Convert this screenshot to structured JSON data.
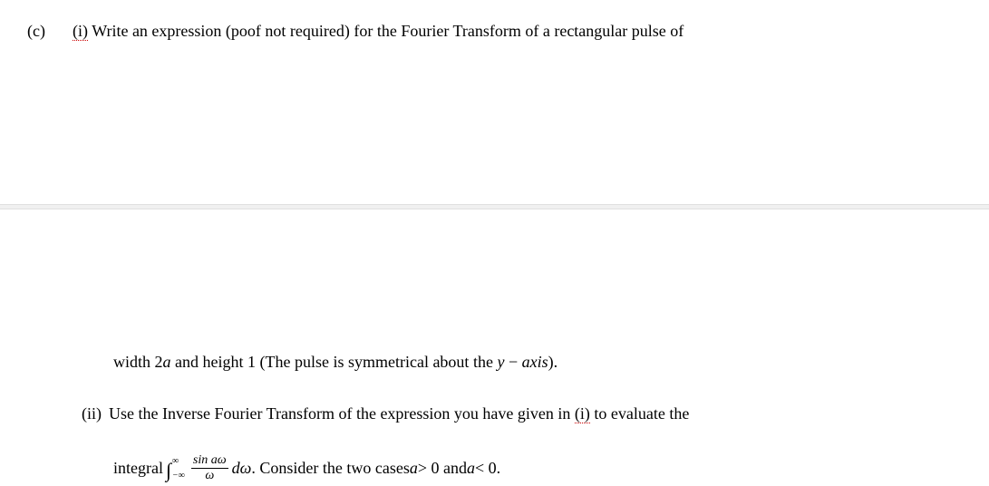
{
  "part": {
    "label": "(c)",
    "sub_i_label": "(i)",
    "sub_i_text": "Write an expression (poof not required) for the Fourier Transform of a rectangular pulse of",
    "width_line_prefix": "width 2",
    "width_var": "a",
    "width_line_mid": " and height 1 (The pulse is symmetrical about the ",
    "y_var": "y",
    "minus": " − ",
    "axis_word": "axis",
    "width_line_suffix": ").",
    "sub_ii_label": "(ii)",
    "sub_ii_text_a": "Use the Inverse Fourier Transform of the expression you have given in ",
    "sub_ii_i_ref": "(i)",
    "sub_ii_text_b": " to evaluate the",
    "integral_word": "integral ",
    "int_sym": "∫",
    "limit_top": "∞",
    "limit_bot": "−∞",
    "frac_num": "sin aω",
    "frac_den": "ω",
    "d_omega": "dω",
    "consider_text": ". Consider the two cases  ",
    "a_gt": "a",
    "gt_text": " > 0 and ",
    "a_lt": "a",
    "lt_text": " < 0."
  }
}
